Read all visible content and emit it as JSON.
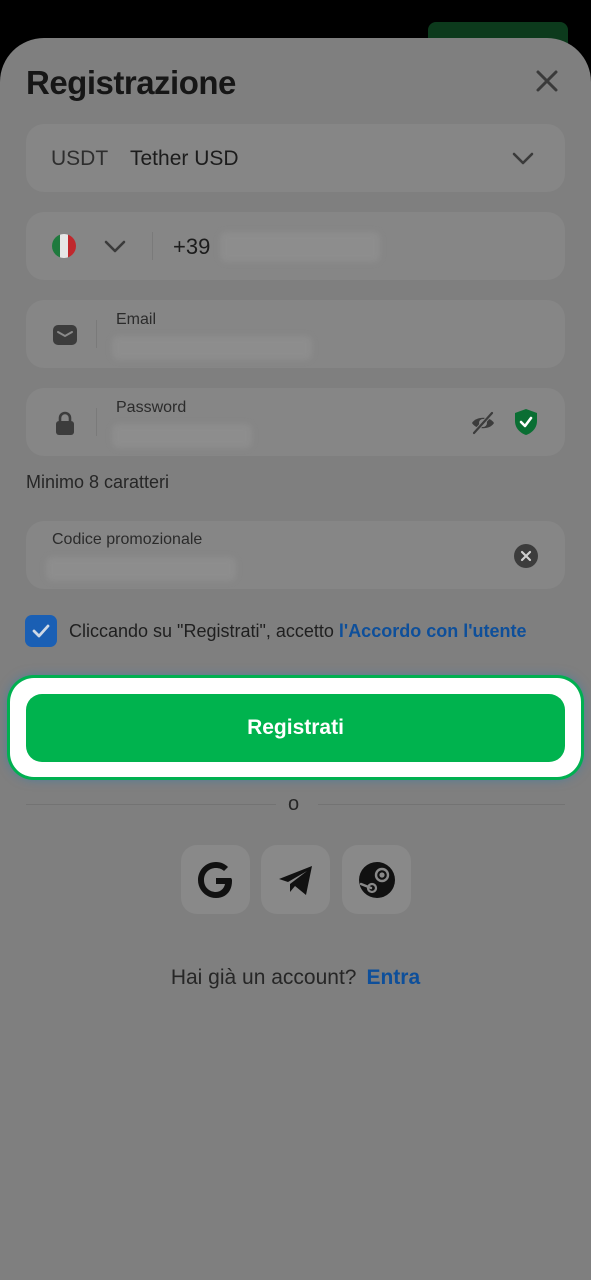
{
  "sheet": {
    "title": "Registrazione"
  },
  "currency": {
    "code": "USDT",
    "name": "Tether USD"
  },
  "phone": {
    "prefix": "+39",
    "country": "Italy"
  },
  "email": {
    "label": "Email"
  },
  "password": {
    "label": "Password",
    "hint": "Minimo 8 caratteri"
  },
  "promo": {
    "label": "Codice promozionale"
  },
  "terms": {
    "text": "Cliccando su \"Registrati\", accetto ",
    "link": "l'Accordo con l'utente",
    "checked": true
  },
  "register_button": {
    "label": "Registrati"
  },
  "separator": {
    "label": "o"
  },
  "social": [
    "google-icon",
    "telegram-icon",
    "steam-icon"
  ],
  "footer": {
    "question": "Hai già un account?",
    "login_link": "Entra"
  },
  "colors": {
    "accent": "#00b34e",
    "link": "#0e4f9a",
    "checkbox": "#1a5fb4"
  }
}
